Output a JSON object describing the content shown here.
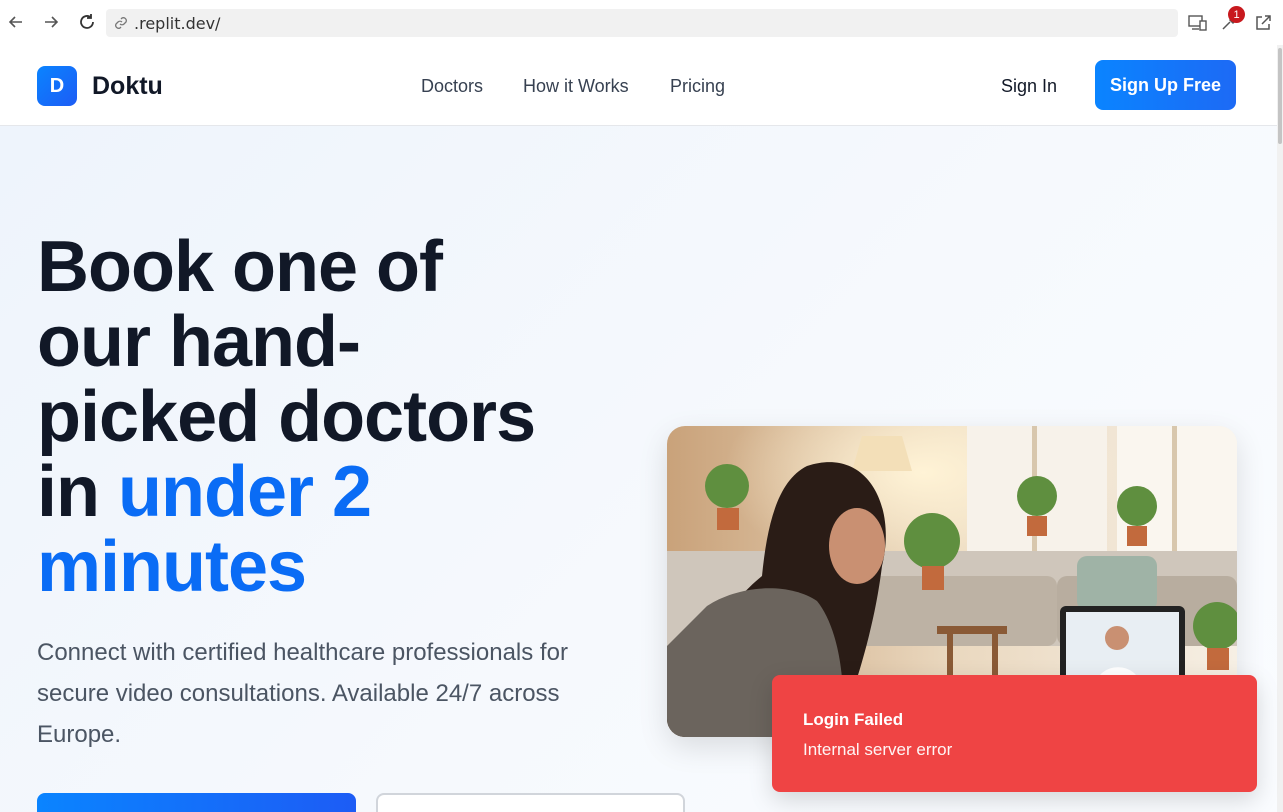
{
  "browser": {
    "url": ".replit.dev/",
    "notification_count": "1"
  },
  "header": {
    "logo_letter": "D",
    "brand": "Doktu",
    "nav": [
      "Doctors",
      "How it Works",
      "Pricing"
    ],
    "sign_in": "Sign In",
    "sign_up": "Sign Up Free"
  },
  "hero": {
    "title_line1": "Book one of",
    "title_line2": "our hand-",
    "title_line3": "picked doctors",
    "title_line4_prefix": "in ",
    "title_line4_accent": "under 2",
    "title_line5_accent": "minutes",
    "subtitle": "Connect with certified healthcare professionals for secure video consultations. Available 24/7 across Europe."
  },
  "toast": {
    "title": "Login Failed",
    "message": "Internal server error"
  },
  "colors": {
    "accent": "#0a6cf5",
    "toast_bg": "#ef4444",
    "brand_gradient_start": "#0a84ff",
    "brand_gradient_end": "#1d5cf5"
  }
}
